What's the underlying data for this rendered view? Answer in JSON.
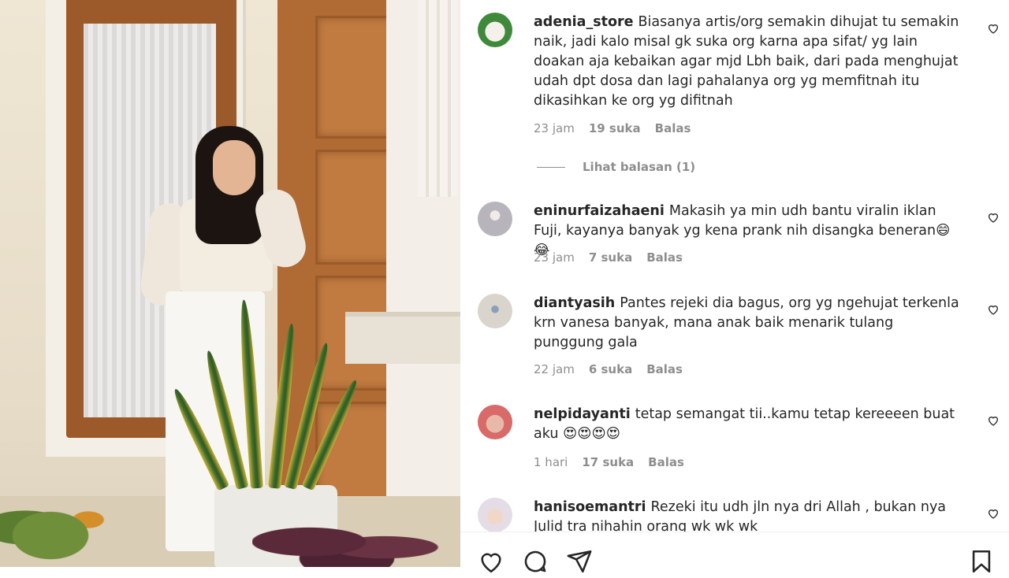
{
  "photo": {
    "alt": ""
  },
  "comments": [
    {
      "username": "adenia_store",
      "text": "Biasanya artis/org semakin dihujat tu semakin naik, jadi kalo misal gk suka org karna apa sifat/ yg lain doakan aja kebaikan agar mjd Lbh baik, dari pada menghujat udah dpt dosa dan lagi pahalanya org yg memfitnah itu dikasihkan ke org yg difitnah",
      "time": "23 jam",
      "likes": "19 suka",
      "reply": "Balas",
      "view_replies": "Lihat balasan (1)",
      "avatar_color": "#3f8a3a"
    },
    {
      "username": "eninurfaizahaeni",
      "text": "Makasih ya min udh bantu viralin iklan Fuji, kayanya banyak yg kena prank nih disangka beneran😄😂",
      "time": "23 jam",
      "likes": "7 suka",
      "reply": "Balas",
      "avatar_color": "#c9c9cf"
    },
    {
      "username": "diantyasih",
      "text": "Pantes rejeki dia bagus, org yg ngehujat terkenla krn vanesa banyak, mana anak baik menarik tulang punggung gala",
      "time": "22 jam",
      "likes": "6 suka",
      "reply": "Balas",
      "avatar_color": "#d9d4cc"
    },
    {
      "username": "nelpidayanti",
      "text": "tetap semangat tii..kamu tetap kereeeen buat aku 😍😍😍😍",
      "time": "1 hari",
      "likes": "17 suka",
      "reply": "Balas",
      "avatar_color": "#e8b9a8"
    },
    {
      "username": "hanisoemantri",
      "text": "Rezeki itu udh jln nya dri Allah , bukan nya Julid tra nihahin orang wk wk wk",
      "time": "",
      "likes": "",
      "reply": "",
      "avatar_color": "#e4dde6"
    }
  ],
  "actions": {
    "like_icon": "heart-outline-icon",
    "comment_icon": "comment-bubble-icon",
    "share_icon": "paper-plane-icon",
    "save_icon": "bookmark-icon"
  }
}
